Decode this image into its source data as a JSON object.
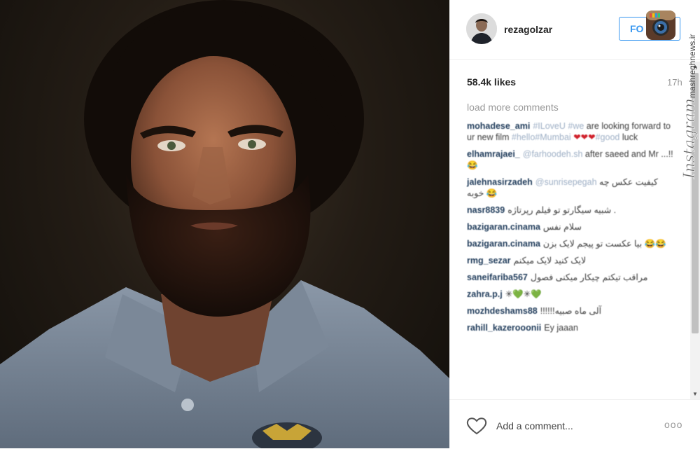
{
  "profile": {
    "username": "rezagolzar",
    "follow_label": "FOLLOW",
    "follow_visible": "FO"
  },
  "post": {
    "likes": "58.4k likes",
    "time": "17h",
    "load_more": "load more comments"
  },
  "comments": [
    {
      "user": "mohadese_ami",
      "parts": [
        [
          "h",
          "#ILoveU"
        ],
        [
          "t",
          " "
        ],
        [
          "h",
          "#we"
        ],
        [
          "t",
          " are looking forward to ur new film "
        ],
        [
          "h",
          "#hello"
        ],
        [
          "h",
          "#Mumbai"
        ],
        [
          "t",
          " "
        ],
        [
          "r",
          "❤❤❤"
        ],
        [
          "h",
          "#good"
        ],
        [
          "t",
          " luck"
        ]
      ]
    },
    {
      "user": "elhamrajaei_",
      "parts": [
        [
          "h",
          "@farhoodeh.sh"
        ],
        [
          "t",
          " after saeed and Mr ...!!😂"
        ]
      ]
    },
    {
      "user": "jalehnasirzadeh",
      "parts": [
        [
          "h",
          "@sunrisepegah"
        ],
        [
          "t",
          " کیفیت عکس چه خوبه 😂"
        ]
      ]
    },
    {
      "user": "nasr8839",
      "parts": [
        [
          "t",
          "شبیه سیگارتو تو فیلم رپرتاژه ."
        ]
      ]
    },
    {
      "user": "bazigaran.cinama",
      "parts": [
        [
          "t",
          "سلام نفس"
        ]
      ]
    },
    {
      "user": "bazigaran.cinama",
      "parts": [
        [
          "t",
          "بیا عکست تو پیجم لایک بزن 😂😂"
        ]
      ]
    },
    {
      "user": "rmg_sezar",
      "parts": [
        [
          "t",
          "لایک کنید لایک میکنم"
        ]
      ]
    },
    {
      "user": "saneifariba567",
      "parts": [
        [
          "t",
          "مراقب تیکتم چیکار میکنی فصول"
        ]
      ]
    },
    {
      "user": "zahra.p.j",
      "parts": [
        [
          "t",
          "✳💚✳💚"
        ]
      ]
    },
    {
      "user": "mozhdeshams88",
      "parts": [
        [
          "t",
          "!!!!!!آلی ماه صبیه"
        ]
      ]
    },
    {
      "user": "rahill_kazerooonii",
      "parts": [
        [
          "t",
          "Ey jaaan"
        ]
      ]
    }
  ],
  "footer": {
    "add_comment": "Add a comment...",
    "more": "ooo"
  },
  "watermark": {
    "brand": "Instagram",
    "site": "mashreghnews.ir"
  },
  "colors": {
    "accent": "#3897f0",
    "username": "#1f3b5a",
    "hashtag": "#9fb0c6"
  },
  "icons": {
    "heart": "heart-outline-icon",
    "more": "ellipsis-icon",
    "logo": "instagram-logo-icon"
  }
}
